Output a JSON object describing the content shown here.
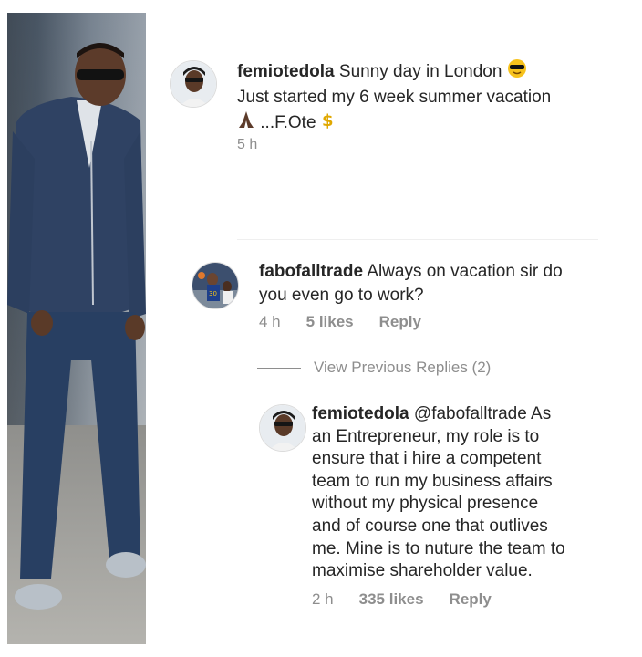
{
  "post": {
    "username": "femiotedola",
    "caption_line1": "Sunny day in London",
    "caption_line2": "Just started my 6 week summer vacation",
    "caption_line3": "...F.Ote",
    "time": "5 h",
    "emojis": [
      "sunglasses-emoji",
      "praying-hands-emoji",
      "dollar-sign-emoji"
    ]
  },
  "comment": {
    "username": "fabofalltrade",
    "text": "Always on vacation sir do you even go to work?",
    "text_line1": "Always on vacation sir do",
    "text_line2": "you even go to work?",
    "time": "4 h",
    "likes": "5 likes",
    "reply_label": "Reply"
  },
  "view_previous_replies": "View Previous Replies (2)",
  "reply": {
    "username": "femiotedola",
    "mention": "@fabofalltrade",
    "line1_tail": "As",
    "lines": [
      "an Entrepreneur, my role is to",
      "ensure that i hire a competent",
      "team to run my business affairs",
      "without my physical presence",
      "and of course one that outlives",
      "me. Mine is to nuture the team to",
      "maximise shareholder value."
    ],
    "time": "2 h",
    "likes": "335 likes",
    "reply_label": "Reply"
  },
  "colors": {
    "text": "#262626",
    "muted": "#8e8e8e",
    "divider": "#efefef"
  }
}
